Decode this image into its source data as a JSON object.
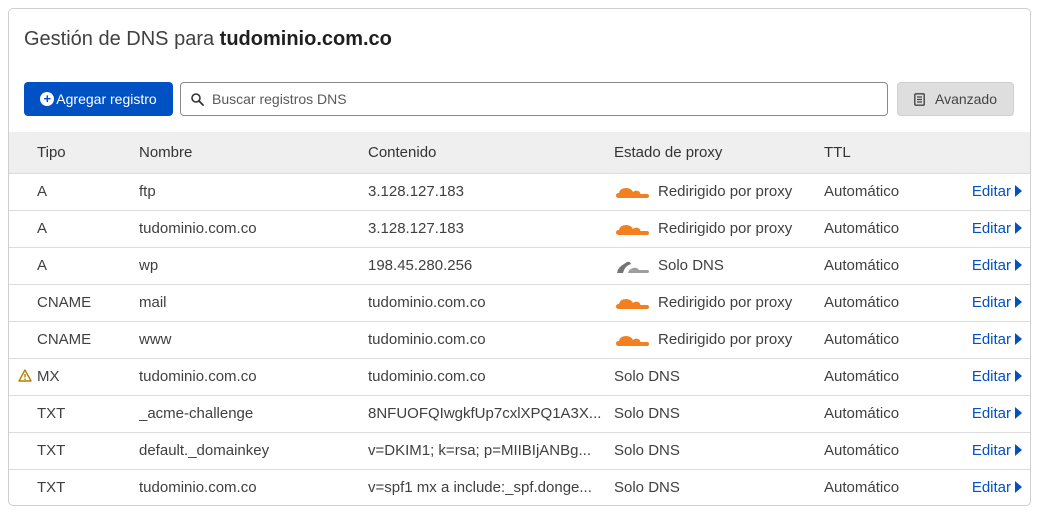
{
  "header": {
    "title_prefix": "Gestión de DNS para",
    "domain": "tudominio.com.co"
  },
  "toolbar": {
    "add_label": "Agregar registro",
    "search_placeholder": "Buscar registros DNS",
    "advanced_label": "Avanzado"
  },
  "table": {
    "columns": {
      "type": "Tipo",
      "name": "Nombre",
      "content": "Contenido",
      "proxy": "Estado de proxy",
      "ttl": "TTL"
    },
    "edit_label": "Editar",
    "rows": [
      {
        "type": "A",
        "name": "ftp",
        "content": "3.128.127.183",
        "proxy": "Redirigido por proxy",
        "proxy_icon": "orange-cloud-icon",
        "ttl": "Automático",
        "warning": false
      },
      {
        "type": "A",
        "name": "tudominio.com.co",
        "content": "3.128.127.183",
        "proxy": "Redirigido por proxy",
        "proxy_icon": "orange-cloud-icon",
        "ttl": "Automático",
        "warning": false
      },
      {
        "type": "A",
        "name": "wp",
        "content": "198.45.280.256",
        "proxy": "Solo DNS",
        "proxy_icon": "gray-cloud-icon",
        "ttl": "Automático",
        "warning": false
      },
      {
        "type": "CNAME",
        "name": "mail",
        "content": "tudominio.com.co",
        "proxy": "Redirigido por proxy",
        "proxy_icon": "orange-cloud-icon",
        "ttl": "Automático",
        "warning": false
      },
      {
        "type": "CNAME",
        "name": "www",
        "content": "tudominio.com.co",
        "proxy": "Redirigido por proxy",
        "proxy_icon": "orange-cloud-icon",
        "ttl": "Automático",
        "warning": false
      },
      {
        "type": "MX",
        "name": "tudominio.com.co",
        "content": "tudominio.com.co",
        "proxy": "Solo DNS",
        "proxy_icon": "",
        "ttl": "Automático",
        "warning": true
      },
      {
        "type": "TXT",
        "name": "_acme-challenge",
        "content": "8NFUOFQIwgkfUp7cxlXPQ1A3X...",
        "proxy": "Solo DNS",
        "proxy_icon": "",
        "ttl": "Automático",
        "warning": false
      },
      {
        "type": "TXT",
        "name": "default._domainkey",
        "content": "v=DKIM1; k=rsa; p=MIIBIjANBg...",
        "proxy": "Solo DNS",
        "proxy_icon": "",
        "ttl": "Automático",
        "warning": false
      },
      {
        "type": "TXT",
        "name": "tudominio.com.co",
        "content": "v=spf1 mx a include:_spf.donge...",
        "proxy": "Solo DNS",
        "proxy_icon": "",
        "ttl": "Automático",
        "warning": false
      }
    ]
  },
  "colors": {
    "accent": "#0051c3",
    "proxied_cloud": "#f38020",
    "dns_only_cloud": "#757575",
    "warning": "#b58100"
  }
}
